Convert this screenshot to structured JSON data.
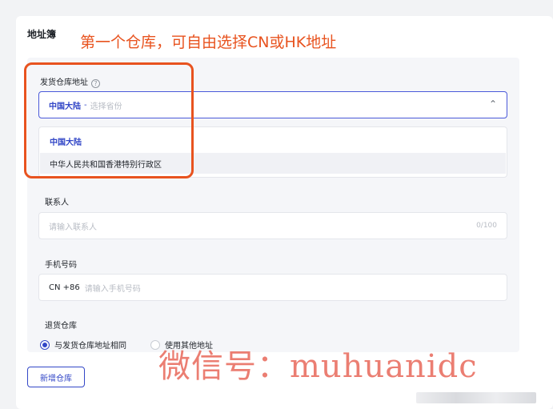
{
  "page": {
    "section_title": "地址簿",
    "annotation": "第一个仓库，可自由选择CN或HK地址"
  },
  "warehouse": {
    "label": "发货仓库地址",
    "help_icon": "question-circle-icon",
    "selected_value": "中国大陆",
    "separator": "-",
    "placeholder": "选择省份",
    "chevron": "chevron-up-icon",
    "options": [
      "中国大陆",
      "中华人民共和国香港特别行政区"
    ]
  },
  "contact": {
    "label": "联系人",
    "placeholder": "请输入联系人",
    "counter": "0/100"
  },
  "phone": {
    "label": "手机号码",
    "prefix": "CN +86",
    "placeholder": "请输入手机号码"
  },
  "return_warehouse": {
    "label": "退货仓库",
    "options": [
      "与发货仓库地址相同",
      "使用其他地址"
    ],
    "selected_index": 0
  },
  "actions": {
    "add_warehouse": "新增仓库"
  },
  "watermark": "微信号：muhuanidc",
  "colors": {
    "accent": "#3347c7",
    "annotation": "#e8531f",
    "watermark": "#e8685a"
  }
}
